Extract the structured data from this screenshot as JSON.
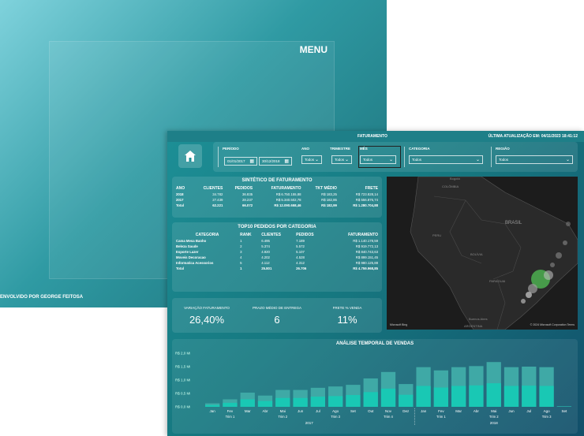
{
  "menu": {
    "title": "MENU",
    "developer": "ENVOLVIDO POR GEORGE FEITOSA"
  },
  "report": {
    "title": "FATURAMENTO",
    "updated": "ÚLTIMA ATUALIZAÇÃO EM: 04/11/2023 18:41:12"
  },
  "filters": {
    "periodo": {
      "label": "PERÍODO",
      "start": "01/01/2017",
      "end": "30/12/2018"
    },
    "ano": {
      "label": "ANO",
      "value": "Todos"
    },
    "trimestre": {
      "label": "TRIMESTRE",
      "value": "Todos"
    },
    "mes": {
      "label": "MÊS",
      "value": "Todos"
    },
    "categoria": {
      "label": "CATEGORIA",
      "value": "Todos"
    },
    "regiao": {
      "label": "REGIÃO",
      "value": "Todos"
    }
  },
  "sintetico": {
    "title": "SINTÉTICO DE FATURAMENTO",
    "headers": [
      "ANO",
      "CLIENTES",
      "PEDIDOS",
      "FATURAMENTO",
      "TKT MÉDIO",
      "FRETE"
    ],
    "rows": [
      [
        "2018",
        "34.782",
        "36.835",
        "R$ 6.750.155,88",
        "R$ 183,25",
        "R$ 723.828,14"
      ],
      [
        "2017",
        "27.439",
        "28.237",
        "R$ 5.340.502,78",
        "R$ 182,86",
        "R$ 556.876,74"
      ],
      [
        "Total",
        "62.221",
        "66.072",
        "R$ 12.090.658,46",
        "R$ 182,99",
        "R$ 1.280.704,88"
      ]
    ]
  },
  "top10": {
    "title": "TOP10 PEDIDOS POR CATEGORIA",
    "headers": [
      "CATEGORIA",
      "RANK",
      "CLIENTES",
      "PEDIDOS",
      "FATURAMENTO"
    ],
    "rows": [
      [
        "Cama Mesa Banho",
        "1",
        "6.495",
        "7.189",
        "R$ 1.140.178,59"
      ],
      [
        "Beleza Saude",
        "2",
        "5.374",
        "5.572",
        "R$ 919.772,13"
      ],
      [
        "Esporte Lazer",
        "3",
        "4.920",
        "5.107",
        "R$ 840.743,63"
      ],
      [
        "Moveis Decoracao",
        "4",
        "4.202",
        "4.528",
        "R$ 899.151,45"
      ],
      [
        "Informatica Acessorios",
        "5",
        "4.112",
        "4.312",
        "R$ 980.125,88"
      ],
      [
        "Total",
        "1",
        "25.801",
        "26.706",
        "R$ 4.759.968,85"
      ]
    ]
  },
  "kpis": [
    {
      "label": "VARIAÇÃO FATURAMENTO",
      "value": "26,40%"
    },
    {
      "label": "PRAZO MÉDIO DE ENTREGA",
      "value": "6"
    },
    {
      "label": "FRETE % VENDA",
      "value": "11%"
    }
  ],
  "map": {
    "places": [
      "Bogotá",
      "COLÔMBIA",
      "PERU",
      "BRASIL",
      "BOLÍVIA",
      "PARAGUAI",
      "Buenos Aires",
      "ARGENTINA"
    ],
    "attribution": "© 2024 Microsoft Corporation  Terms",
    "logo": "Microsoft Bing"
  },
  "chart_data": {
    "type": "bar",
    "title": "ANÁLISE TEMPORAL DE VENDAS",
    "ytick_labels": [
      "R$ 0,0 Mi",
      "R$ 0,5 Mi",
      "R$ 1,0 Mi",
      "R$ 1,5 Mi",
      "R$ 2,0 Mi"
    ],
    "ylim": [
      0,
      2.0
    ],
    "categories": [
      "Jan",
      "Fev",
      "Mar",
      "Abr",
      "Mai",
      "Jun",
      "Jul",
      "Ago",
      "Set",
      "Out",
      "Nov",
      "Dez",
      "Jan",
      "Fev",
      "Mar",
      "Abr",
      "Mai",
      "Jun",
      "Jul",
      "Ago",
      "Set"
    ],
    "series": [
      {
        "values": [
          0.07,
          0.15,
          0.28,
          0.22,
          0.33,
          0.33,
          0.38,
          0.4,
          0.44,
          0.55,
          0.68,
          0.45,
          0.78,
          0.72,
          0.78,
          0.8,
          0.88,
          0.78,
          0.79,
          0.78,
          0.01
        ]
      },
      {
        "values": [
          0.13,
          0.28,
          0.53,
          0.42,
          0.63,
          0.63,
          0.71,
          0.76,
          0.82,
          1.06,
          1.3,
          0.85,
          1.48,
          1.36,
          1.48,
          1.52,
          1.67,
          1.48,
          1.5,
          1.48,
          0.02
        ]
      }
    ],
    "trimester_labels": [
      "Trim 1",
      "Trim 2",
      "Trim 3",
      "Trim 4",
      "Trim 1",
      "Trim 2",
      "Trim 3"
    ],
    "year_labels": [
      "2017",
      "2018"
    ],
    "colors": {
      "bar": "#19c8b4",
      "bar_light": "#3fa9a6"
    }
  }
}
